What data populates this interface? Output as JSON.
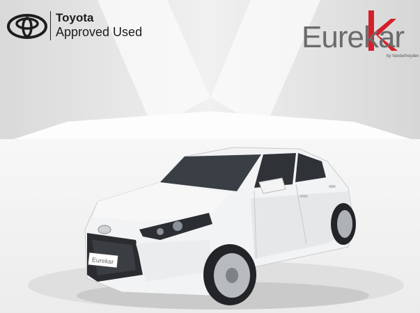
{
  "header": {
    "toyota_brand": "Toyota",
    "toyota_sub": "Approved Used",
    "dealer_name": "Eurekar",
    "dealer_tag": "by Vanderheyden"
  },
  "car": {
    "plate_text": "Eurekar",
    "body_color": "#f2f3f4"
  },
  "colors": {
    "dealer_grey": "#6b6b6b",
    "dealer_red": "#d5202a"
  }
}
